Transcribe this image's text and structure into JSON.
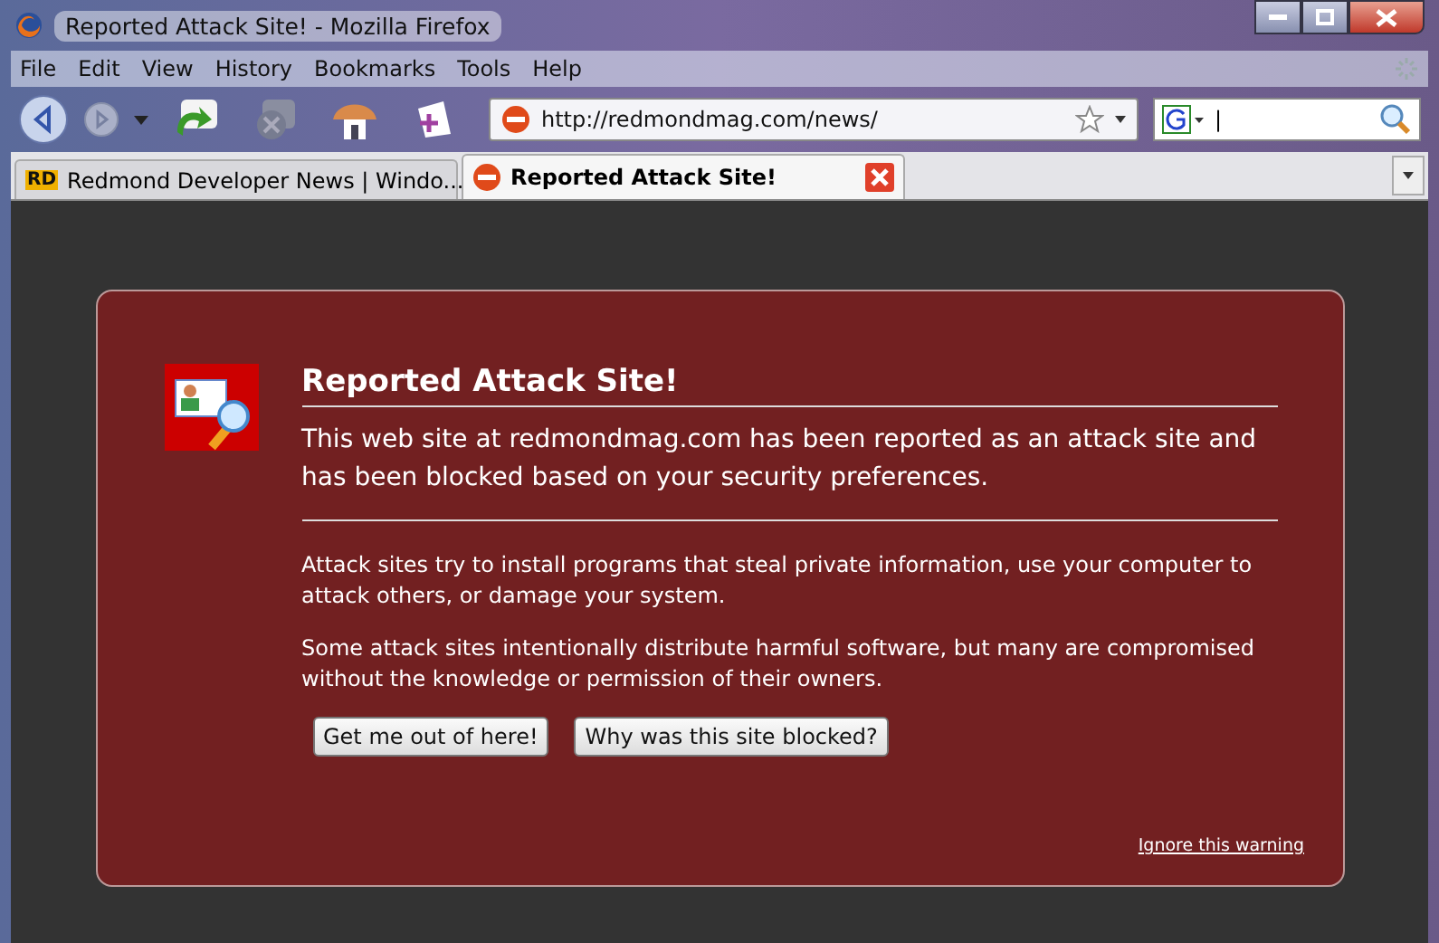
{
  "window": {
    "title": "Reported Attack Site! - Mozilla Firefox"
  },
  "menu": [
    "File",
    "Edit",
    "View",
    "History",
    "Bookmarks",
    "Tools",
    "Help"
  ],
  "address_bar": {
    "value": "http://redmondmag.com/news/"
  },
  "search": {
    "value": "|"
  },
  "tabs": [
    {
      "label": "Redmond Developer News | Windo...",
      "selected": false,
      "favicon": "RD"
    },
    {
      "label": "Reported Attack Site!",
      "selected": true
    }
  ],
  "page": {
    "title": "Reported Attack Site!",
    "intro": "This web site at redmondmag.com has been reported as an attack site and has been blocked based on your security preferences.",
    "paragraphs": [
      "Attack sites try to install programs that steal private information, use your computer to attack others, or damage your system.",
      "Some attack sites intentionally distribute harmful software, but many are compromised without the knowledge or permission of their owners."
    ],
    "buttons": [
      "Get me out of here!",
      "Why was this site blocked?"
    ],
    "ignore_link": "Ignore this warning"
  }
}
